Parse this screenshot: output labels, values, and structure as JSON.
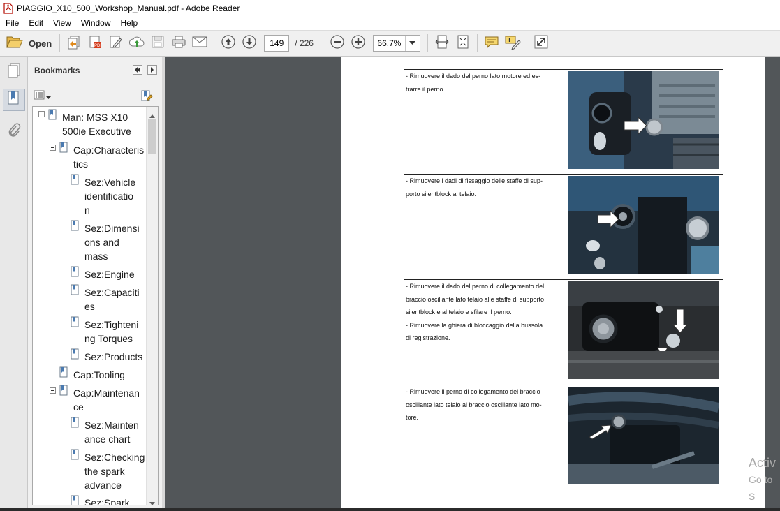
{
  "window": {
    "title": "PIAGGIO_X10_500_Workshop_Manual.pdf - Adobe Reader"
  },
  "menu": [
    "File",
    "Edit",
    "View",
    "Window",
    "Help"
  ],
  "toolbar": {
    "open_label": "Open",
    "page_current": "149",
    "page_total": "/ 226",
    "zoom": "66.7%"
  },
  "bookmarks": {
    "title": "Bookmarks",
    "tree": [
      {
        "lines": [
          "Man: MSS X10",
          "500ie Executive"
        ]
      },
      {
        "lines": [
          "Cap:Characteris",
          "tics"
        ]
      },
      {
        "lines": [
          "Sez:Vehicle",
          "identificatio",
          "n"
        ]
      },
      {
        "lines": [
          "Sez:Dimensi",
          "ons and",
          "mass"
        ]
      },
      {
        "lines": [
          "Sez:Engine"
        ]
      },
      {
        "lines": [
          "Sez:Capaciti",
          "es"
        ]
      },
      {
        "lines": [
          "Sez:Tighteni",
          "ng Torques"
        ]
      },
      {
        "lines": [
          "Sez:Products"
        ]
      },
      {
        "lines": [
          "Cap:Tooling"
        ]
      },
      {
        "lines": [
          "Cap:Maintenan",
          "ce"
        ]
      },
      {
        "lines": [
          "Sez:Mainten",
          "ance chart"
        ]
      },
      {
        "lines": [
          "Sez:Checking",
          "the spark",
          "advance"
        ]
      },
      {
        "lines": [
          "Sez:Spark"
        ]
      }
    ]
  },
  "document": {
    "steps": [
      {
        "lines": [
          "- Rimuovere il dado del perno lato motore ed es-",
          "trarre il perno."
        ]
      },
      {
        "lines": [
          "- Rimuovere i dadi di fissaggio delle staffe di sup-",
          "porto silentblock al telaio."
        ]
      },
      {
        "lines": [
          "- Rimuovere il dado del perno di collegamento del",
          "braccio oscillante lato telaio alle staffe di supporto",
          "silentblock e al telaio e sfilare il perno.",
          "- Rimuovere la ghiera di bloccaggio della bussola",
          "di registrazione."
        ]
      },
      {
        "lines": [
          "- Rimuovere il perno di collegamento del braccio",
          "oscillante lato telaio al braccio oscillante lato mo-",
          "tore."
        ]
      }
    ]
  },
  "watermark": {
    "line1": "Activ",
    "line2": "Go to S"
  },
  "icons": {
    "app": "pdf-file-icon",
    "open": "folder-open-icon",
    "prev_page": "arrow-up-circle-icon",
    "next_page": "arrow-down-circle-icon",
    "zoom_out": "minus-circle-icon",
    "zoom_in": "plus-circle-icon"
  }
}
